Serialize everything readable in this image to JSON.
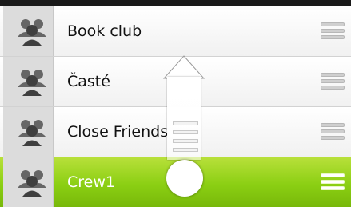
{
  "groups": [
    {
      "label": "Book club",
      "icon": "people-icon"
    },
    {
      "label": "Časté",
      "icon": "people-icon"
    },
    {
      "label": "Close Friends",
      "icon": "people-icon"
    },
    {
      "label": "Crew1",
      "icon": "people-icon",
      "active": true
    }
  ],
  "colors": {
    "active_row": "#8bcf13",
    "icon_background": "#dcdcdc",
    "handle": "#cfcfcf"
  },
  "gesture": {
    "direction": "up",
    "icon": "swipe-up-arrow-icon"
  }
}
